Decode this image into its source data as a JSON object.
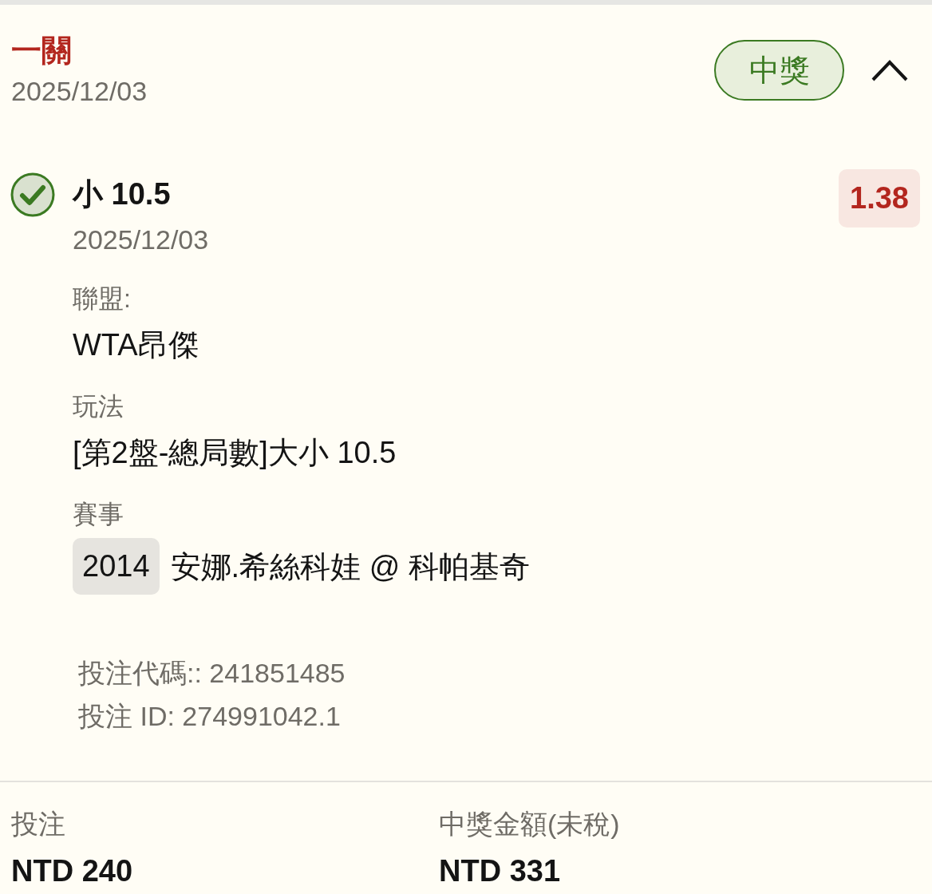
{
  "bet": {
    "type_label": "一關",
    "date": "2025/12/03",
    "status": {
      "label": "中獎",
      "kind": "won"
    },
    "expanded": true
  },
  "selections": [
    {
      "kind": "won",
      "pick": "小 10.5",
      "date": "2025/12/03",
      "odds": "1.38",
      "fields": [
        {
          "label": "聯盟:",
          "value": "WTA昂傑"
        },
        {
          "label": "玩法",
          "value": "[第2盤-總局數]大小 10.5"
        },
        {
          "label": "賽事",
          "event_code": "2014",
          "value": "安娜.希絲科娃 @ 科帕基奇"
        }
      ]
    }
  ],
  "references": [
    "投注代碼:: 241851485",
    "投注 ID: 274991042.1"
  ],
  "summary": [
    {
      "label": "投注",
      "value": "NTD 240"
    },
    {
      "label": "中獎金額(未稅)",
      "value": "NTD 331"
    }
  ]
}
